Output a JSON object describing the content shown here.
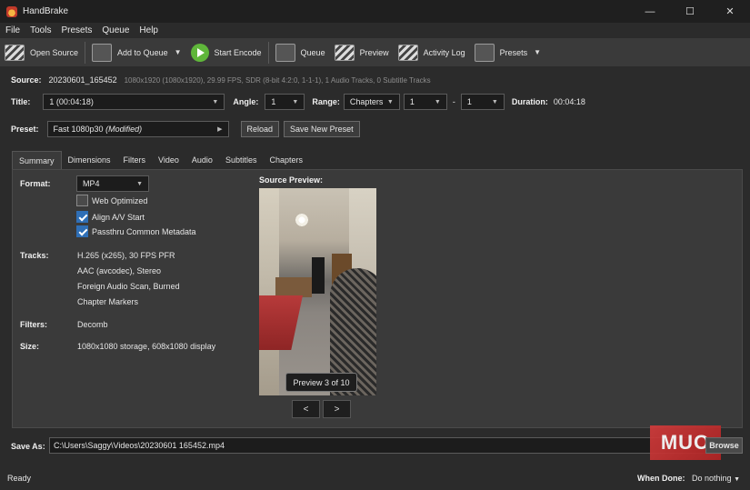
{
  "window": {
    "title": "HandBrake",
    "controls": [
      "—",
      "☐",
      "✕"
    ]
  },
  "menu": [
    "File",
    "Tools",
    "Presets",
    "Queue",
    "Help"
  ],
  "toolbar": {
    "open_source": "Open Source",
    "add_to_queue": "Add to Queue",
    "start_encode": "Start Encode",
    "queue": "Queue",
    "preview": "Preview",
    "activity_log": "Activity Log",
    "presets": "Presets"
  },
  "source": {
    "label": "Source:",
    "name": "20230601_165452",
    "info": "1080x1920 (1080x1920), 29.99 FPS, SDR (8-bit 4:2:0, 1-1-1), 1 Audio Tracks, 0 Subtitle Tracks"
  },
  "title_row": {
    "title_label": "Title:",
    "title_value": "1  (00:04:18)",
    "angle_label": "Angle:",
    "angle_value": "1",
    "range_label": "Range:",
    "range_mode": "Chapters",
    "range_start": "1",
    "range_dash": "-",
    "range_end": "1",
    "duration_label": "Duration:",
    "duration_value": "00:04:18"
  },
  "preset_row": {
    "label": "Preset:",
    "value": "Fast 1080p30",
    "modified": "(Modified)",
    "reload": "Reload",
    "save_new": "Save New Preset"
  },
  "tabs": [
    "Summary",
    "Dimensions",
    "Filters",
    "Video",
    "Audio",
    "Subtitles",
    "Chapters"
  ],
  "summary": {
    "format_label": "Format:",
    "format_value": "MP4",
    "web_optimized": "Web Optimized",
    "align_av": "Align A/V Start",
    "passthru": "Passthru Common Metadata",
    "tracks_label": "Tracks:",
    "tracks": [
      "H.265 (x265), 30 FPS PFR",
      "AAC (avcodec), Stereo",
      "Foreign Audio Scan, Burned",
      "Chapter Markers"
    ],
    "filters_label": "Filters:",
    "filters_value": "Decomb",
    "size_label": "Size:",
    "size_value": "1080x1080 storage, 608x1080 display",
    "source_preview_label": "Source Preview:",
    "preview_badge": "Preview 3 of 10",
    "prev": "<",
    "next": ">"
  },
  "save": {
    "label": "Save As:",
    "path": "C:\\Users\\Saggy\\Videos\\20230601 165452.mp4",
    "browse": "Browse"
  },
  "watermark": "MUO",
  "status": {
    "text": "Ready",
    "when_done_label": "When Done:",
    "when_done_value": "Do nothing"
  }
}
